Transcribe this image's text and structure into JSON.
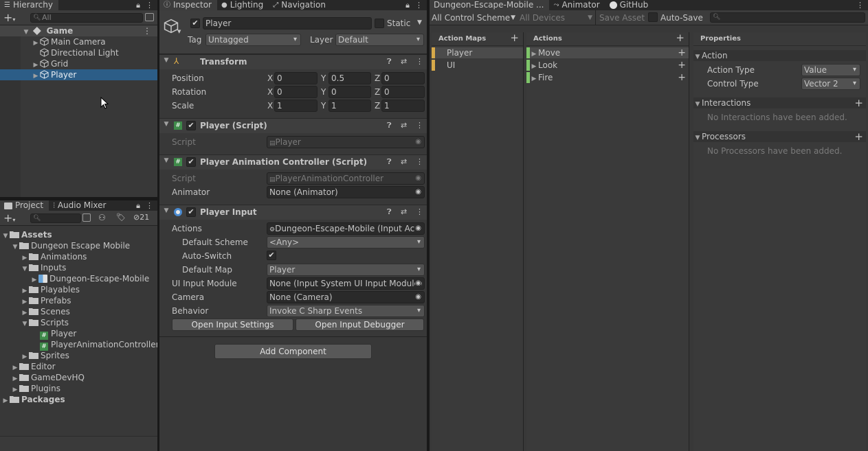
{
  "hierarchy": {
    "tab": "Hierarchy",
    "search_placeholder": "All",
    "scene": "Game",
    "items": [
      "Main Camera",
      "Directional Light",
      "Grid",
      "Player"
    ]
  },
  "project": {
    "tabs": [
      "Project",
      "Audio Mixer"
    ],
    "hidden_count": "21",
    "tree": {
      "assets": "Assets",
      "dungeon": "Dungeon Escape Mobile",
      "animations": "Animations",
      "inputs": "Inputs",
      "input_asset": "Dungeon-Escape-Mobile",
      "playables": "Playables",
      "prefabs": "Prefabs",
      "scenes": "Scenes",
      "scripts": "Scripts",
      "script_player": "Player",
      "script_anim": "PlayerAnimationController",
      "sprites": "Sprites",
      "editor": "Editor",
      "gamedevhq": "GameDevHQ",
      "plugins": "Plugins",
      "packages": "Packages"
    }
  },
  "inspector": {
    "tabs": [
      "Inspector",
      "Lighting",
      "Navigation"
    ],
    "object_name": "Player",
    "static_label": "Static",
    "tag_label": "Tag",
    "tag_value": "Untagged",
    "layer_label": "Layer",
    "layer_value": "Default",
    "transform": {
      "title": "Transform",
      "position_label": "Position",
      "rotation_label": "Rotation",
      "scale_label": "Scale",
      "position": [
        "0",
        "0.5",
        "0"
      ],
      "rotation": [
        "0",
        "0",
        "0"
      ],
      "scale": [
        "1",
        "1",
        "1"
      ],
      "axes": [
        "X",
        "Y",
        "Z"
      ]
    },
    "player_script": {
      "title": "Player (Script)",
      "script_label": "Script",
      "script_value": "Player"
    },
    "anim_script": {
      "title": "Player Animation Controller (Script)",
      "script_label": "Script",
      "script_value": "PlayerAnimationController",
      "animator_label": "Animator",
      "animator_value": "None (Animator)"
    },
    "player_input": {
      "title": "Player Input",
      "actions_label": "Actions",
      "actions_value": "Dungeon-Escape-Mobile (Input Ac",
      "scheme_label": "Default Scheme",
      "scheme_value": "<Any>",
      "autoswitch_label": "Auto-Switch",
      "map_label": "Default Map",
      "map_value": "Player",
      "uimodule_label": "UI Input Module",
      "uimodule_value": "None (Input System UI Input Module)",
      "camera_label": "Camera",
      "camera_value": "None (Camera)",
      "behavior_label": "Behavior",
      "behavior_value": "Invoke C Sharp Events",
      "settings_button": "Open Input Settings",
      "debugger_button": "Open Input Debugger"
    },
    "add_component": "Add Component"
  },
  "input_editor": {
    "tabs": [
      "Dungeon-Escape-Mobile ...",
      "Animator",
      "GitHub"
    ],
    "control_schemes": "All Control Schemes",
    "devices": "All Devices",
    "save_asset": "Save Asset",
    "auto_save": "Auto-Save",
    "action_maps_header": "Action Maps",
    "action_maps": [
      "Player",
      "UI"
    ],
    "actions_header": "Actions",
    "actions": [
      "Move",
      "Look",
      "Fire"
    ],
    "properties_header": "Properties",
    "action_section": "Action",
    "action_type_label": "Action Type",
    "action_type_value": "Value",
    "control_type_label": "Control Type",
    "control_type_value": "Vector 2",
    "interactions_section": "Interactions",
    "interactions_empty": "No Interactions have been added.",
    "processors_section": "Processors",
    "processors_empty": "No Processors have been added."
  },
  "colors": {
    "selection": "#2c5d87",
    "map_marker": "#d6a94a",
    "action_marker": "#7fc66a"
  }
}
